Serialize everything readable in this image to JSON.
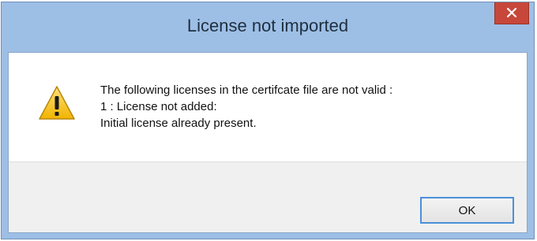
{
  "dialog": {
    "title": "License not imported",
    "close_icon": "close-icon",
    "warning_icon": "warning-icon",
    "message": {
      "line1": "The following licenses in the certifcate file are not valid :",
      "line2": "1 : License not added:",
      "line3": "Initial license already present."
    },
    "ok_label": "OK"
  },
  "colors": {
    "frame": "#9dbfe6",
    "close_button": "#c7473a",
    "button_area": "#f0f0f0",
    "ok_focus_border": "#4a90d9",
    "warning_fill": "#f5c21b"
  }
}
